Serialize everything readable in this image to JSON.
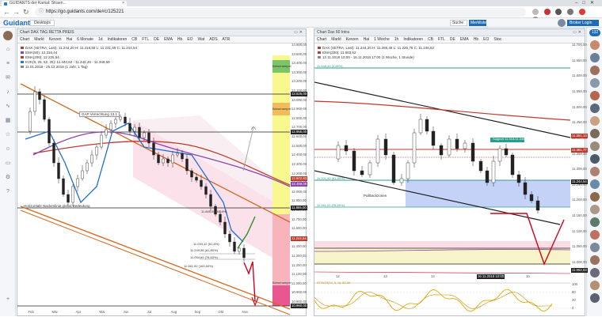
{
  "browser": {
    "tab_title": "GUIDANTS der Kamal: Straen...",
    "url": "https://go.guidants.com/de#c/125221",
    "url_lock": "ⓘ",
    "close": "×"
  },
  "app": {
    "logo_main": "Guidant",
    "logo_accent": "s",
    "desktop_btn": "Desktops",
    "search_btn": "Suche",
    "merkliste_btn": "Merkliste",
    "broker_btn": "Broker Login"
  },
  "right_badge": "132",
  "left_chart": {
    "window_title": "Chart DAX TAG RETTA PREIS",
    "toolbar": [
      "Chart",
      "Markt",
      "Kerzen",
      "Hai",
      "6 Monate",
      "1d",
      "Indikatoren",
      "CB",
      "FTL",
      "DE",
      "EMA",
      "Hb",
      "EO",
      "Wat",
      "ADS",
      "ATR"
    ],
    "legend": [
      {
        "text": "DAX (XETRA, Last): 11.244,20  H: 11.418,55  L: 11.231,59  C: 11.244,54",
        "color": "#c0392b"
      },
      {
        "text": "EMA(50): 12.316,44",
        "color": "#8e44ad"
      },
      {
        "text": "EMA(200): 12.225,54",
        "color": "#c0392b"
      },
      {
        "text": "KVK(9, 26, 52, 26): 11.440,62 · 11.442,26 · 11.349,60",
        "color": "#2980b9"
      },
      {
        "text": "11.01.2018 - 25.12.2018 (1 Jahr, 1 Tag)",
        "color": "#888888"
      }
    ],
    "annotations": {
      "gap": "GAP Verrechtung 13.1",
      "neckline": "Horizontale Nackenlinie global Bedeutung",
      "zone1": "Börsenampel",
      "zone2": "Börsenampel",
      "zone3": "Börsenampel",
      "fib1": "11.093,12 (61,8%)",
      "fib2": "11.865,00 (61,8%)",
      "fib3": "11.249,56 (61,80%)",
      "fib4": "11.054,69 (78,60%)",
      "fib5": "11.061,00 (100,00%)"
    },
    "price_axis": [
      "13.600,00",
      "13.500,00",
      "13.400,00",
      "13.300,00",
      "13.200,00",
      "13.100,00",
      "13.000,00",
      "12.900,00",
      "12.800,00",
      "12.700,00",
      "12.600,00",
      "12.500,00",
      "12.400,00",
      "12.300,00",
      "12.200,00",
      "12.100,00",
      "12.000,00",
      "11.900,00",
      "11.800,00",
      "11.700,00",
      "11.600,00",
      "11.500,00",
      "11.400,00",
      "11.300,00",
      "11.200,00",
      "11.100,00",
      "11.000,00",
      "10.900,00",
      "10.800,00"
    ],
    "price_tags": [
      {
        "text": "13.525,00",
        "color": "#222222"
      },
      {
        "text": "12.955,00",
        "color": "#222222"
      },
      {
        "text": "12.502,83",
        "color": "#c0392b"
      },
      {
        "text": "12.459,00",
        "color": "#8e44ad"
      },
      {
        "text": "11.865,00",
        "color": "#222222"
      },
      {
        "text": "11.244,54",
        "color": "#c0392b"
      },
      {
        "text": "10.960,00",
        "color": "#222222"
      }
    ],
    "x_axis": [
      "Feb",
      "Mär",
      "Apr",
      "Mai",
      "Jun",
      "Jul",
      "Aug",
      "Sep",
      "Okt",
      "Nov"
    ]
  },
  "right_chart": {
    "window_title": "Chart Dax 60 Intra",
    "toolbar": [
      "Chart",
      "Markt",
      "Kerzen",
      "Hai",
      "1 Woche",
      "1h",
      "Indikatoren",
      "CB",
      "FTL",
      "DE",
      "EMA",
      "Hb",
      "EO",
      "Stoc"
    ],
    "legend": [
      {
        "text": "DAX (XETRA, Last): 11.244,20  H: 11.265,45  L: 11.225,75  C: 11.246,62",
        "color": "#c0392b"
      },
      {
        "text": "EMA(200): 11.503,52",
        "color": "#c0392b"
      },
      {
        "text": "12.11.2018 10:00 - 16.11.2018 17:00 (1 Woche, 1 Stunde)",
        "color": "#888888"
      }
    ],
    "annotations": {
      "pullback": "Pullbackzonen",
      "support": "Support 11.318-11.336",
      "fib_top": "11.548,40 (0,00%)",
      "fib_mid": "11.201,40 (61,80%)",
      "fib_low": "11.061,20 (78,60%)",
      "date_tag": "16.11.2018 10:00",
      "stoch_legend": "STOCH(14, 3, 3): 52,06"
    },
    "price_axis": [
      "11.700,00",
      "11.650,00",
      "11.600,00",
      "11.550,00",
      "11.500,00",
      "11.450,00",
      "11.400,00",
      "11.350,00",
      "11.300,00",
      "11.250,00",
      "11.200,00",
      "11.150,00",
      "11.100,00",
      "11.050,00",
      "11.000,00"
    ],
    "price_tags": [
      {
        "text": "11.551,13",
        "color": "#c0392b"
      },
      {
        "text": "11.361,77",
        "color": "#c0392b"
      },
      {
        "text": "11.244,54",
        "color": "#222222"
      },
      {
        "text": "11.062,63",
        "color": "#222222"
      }
    ],
    "stoch_axis": [
      "100",
      "80",
      "20",
      "0"
    ],
    "x_axis": [
      "12",
      "13",
      "14",
      "15",
      "16"
    ]
  }
}
